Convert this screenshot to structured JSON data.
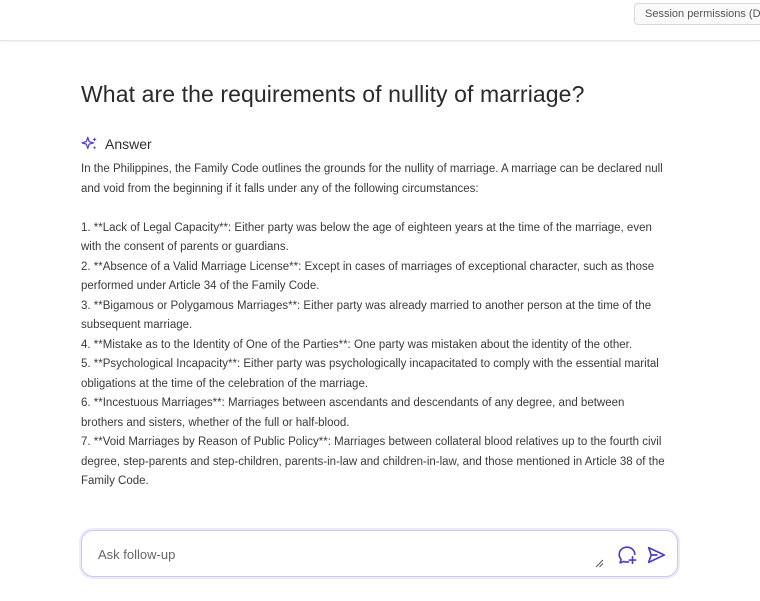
{
  "header": {
    "session_permissions_label": "Session permissions (D"
  },
  "main": {
    "question": "What are the requirements of nullity of marriage?",
    "answer_label": "Answer",
    "answer_icon": "sparkle-icon",
    "intro": "In the Philippines, the Family Code outlines the grounds for the nullity of marriage. A marriage can be declared null and void from the beginning if it falls under any of the following circumstances:",
    "items": [
      "1. **Lack of Legal Capacity**: Either party was below the age of eighteen years at the time of the marriage, even with the consent of parents or guardians.",
      "2. **Absence of a Valid Marriage License**: Except in cases of marriages of exceptional character, such as those performed under Article 34 of the Family Code.",
      "3. **Bigamous or Polygamous Marriages**: Either party was already married to another person at the time of the subsequent marriage.",
      "4. **Mistake as to the Identity of One of the Parties**: One party was mistaken about the identity of the other.",
      "5. **Psychological Incapacity**: Either party was psychologically incapacitated to comply with the essential marital obligations at the time of the celebration of the marriage.",
      "6. **Incestuous Marriages**: Marriages between ascendants and descendants of any degree, and between brothers and sisters, whether of the full or half-blood.",
      "7. **Void Marriages by Reason of Public Policy**: Marriages between collateral blood relatives up to the fourth civil degree, step-parents and step-children, parents-in-law and children-in-law, and those mentioned in Article 38 of the Family Code."
    ]
  },
  "followup": {
    "placeholder": "Ask follow-up",
    "value": ""
  },
  "colors": {
    "accent": "#5b4fd1",
    "input_border": "#cdc7ee"
  }
}
